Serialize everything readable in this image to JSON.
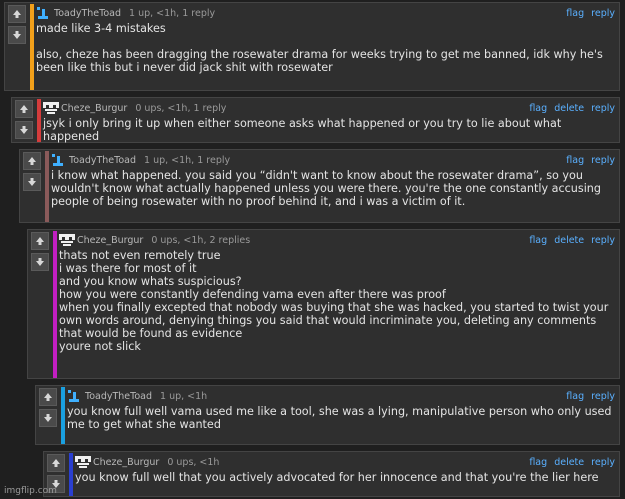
{
  "comments": [
    {
      "user": "ToadyTheToad",
      "avatar": "toad-avatar-icon",
      "meta": "1 up, <1h, 1 reply",
      "actions": [
        "flag",
        "reply"
      ],
      "accent": "#f2a01a",
      "text": "made like 3-4 mistakes\n\nalso, cheze has been dragging the rosewater drama for weeks trying to get me banned, idk why he's been like this but i never did jack shit with rosewater"
    },
    {
      "user": "Cheze_Burgur",
      "avatar": "pixel-face-avatar-icon",
      "meta": "0 ups, <1h, 1 reply",
      "actions": [
        "flag",
        "delete",
        "reply"
      ],
      "accent": "#d43c3c",
      "text": "jsyk i only bring it up when either someone asks what happened or you try to lie about what happened"
    },
    {
      "user": "ToadyTheToad",
      "avatar": "toad-avatar-icon",
      "meta": "1 up, <1h, 1 reply",
      "actions": [
        "flag",
        "reply"
      ],
      "accent": "#8a5a5a",
      "text": "i know what happened. you said you “didn't want to know about the rosewater drama”, so you wouldn't know what actually happened unless you were there. you're the one constantly accusing people of being rosewater with no proof behind it, and i was a victim of it."
    },
    {
      "user": "Cheze_Burgur",
      "avatar": "pixel-face-avatar-icon",
      "meta": "0 ups, <1h, 2 replies",
      "actions": [
        "flag",
        "delete",
        "reply"
      ],
      "accent": "#c21fc2",
      "text": "thats not even remotely true\ni was there for most of it\nand you know whats suspicious?\nhow you were constantly defending vama even after there was proof\nwhen you finally excepted that nobody was buying that she was hacked, you started to twist your own words around, denying things you said that would incriminate you, deleting any comments that would be found as evidence\nyoure not slick"
    },
    {
      "user": "ToadyTheToad",
      "avatar": "toad-avatar-icon",
      "meta": "1 up, <1h",
      "actions": [
        "flag",
        "reply"
      ],
      "accent": "#1aa0e0",
      "text": "you know full well vama used me like a tool, she was a lying, manipulative person who only used me to get what she wanted"
    },
    {
      "user": "Cheze_Burgur",
      "avatar": "pixel-face-avatar-icon",
      "meta": "0 ups, <1h",
      "actions": [
        "flag",
        "delete",
        "reply"
      ],
      "accent": "#2a3fd0",
      "text": "you know full well that you actively advocated for her innocence and that you're the lier here"
    }
  ],
  "watermark": "imgflip.com"
}
